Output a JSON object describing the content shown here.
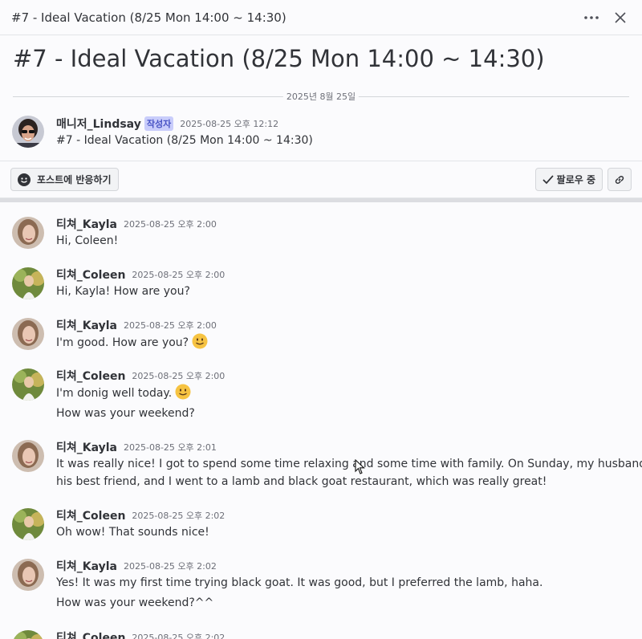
{
  "window": {
    "title": "#7 - Ideal Vacation (8/25 Mon 14:00 ~ 14:30)"
  },
  "post": {
    "title": "#7 - Ideal Vacation (8/25 Mon 14:00 ~ 14:30)",
    "date_divider": "2025년 8월 25일",
    "author": "매니저_Lindsay",
    "author_badge": "작성자",
    "timestamp": "2025-08-25 오후 12:12",
    "text": "#7 - Ideal Vacation (8/25 Mon 14:00 ~ 14:30)"
  },
  "actions": {
    "react_label": "포스트에 반응하기",
    "follow_label": "팔로우 중"
  },
  "messages": [
    {
      "author": "티쳐_Kayla",
      "timestamp": "2025-08-25 오후 2:00",
      "lines": [
        "Hi, Coleen!"
      ]
    },
    {
      "author": "티쳐_Coleen",
      "timestamp": "2025-08-25 오후 2:00",
      "lines": [
        "Hi, Kayla! How are you?"
      ]
    },
    {
      "author": "티쳐_Kayla",
      "timestamp": "2025-08-25 오후 2:00",
      "lines": [
        "I'm good. How are you?"
      ]
    },
    {
      "author": "티쳐_Coleen",
      "timestamp": "2025-08-25 오후 2:00",
      "lines": [
        "I'm donig well today.",
        "How was your weekend?"
      ]
    },
    {
      "author": "티쳐_Kayla",
      "timestamp": "2025-08-25 오후 2:01",
      "lines": [
        "It was really nice! I got to spend some time relaxing and some time with family. On Sunday, my husband,",
        "his best friend, and I went to a lamb and black goat restaurant, which was really great!"
      ]
    },
    {
      "author": "티쳐_Coleen",
      "timestamp": "2025-08-25 오후 2:02",
      "lines": [
        "Oh wow! That sounds nice!"
      ]
    },
    {
      "author": "티쳐_Kayla",
      "timestamp": "2025-08-25 오후 2:02",
      "lines": [
        "Yes! It was my first time trying black goat. It was good, but I preferred the lamb, haha.",
        "How was your weekend?^^"
      ]
    },
    {
      "author": "티쳐_Coleen",
      "timestamp": "2025-08-25 오후 2:02",
      "lines": []
    }
  ],
  "icons": {
    "more": "more-dots-icon",
    "close": "close-icon",
    "smile": "smile-icon",
    "check": "check-icon",
    "link": "link-icon",
    "emoji": "slightly-smiling-face-icon"
  },
  "colors": {
    "badge_bg": "#c9cdfb",
    "badge_text": "#4752c4",
    "emoji": "#f6c342"
  }
}
